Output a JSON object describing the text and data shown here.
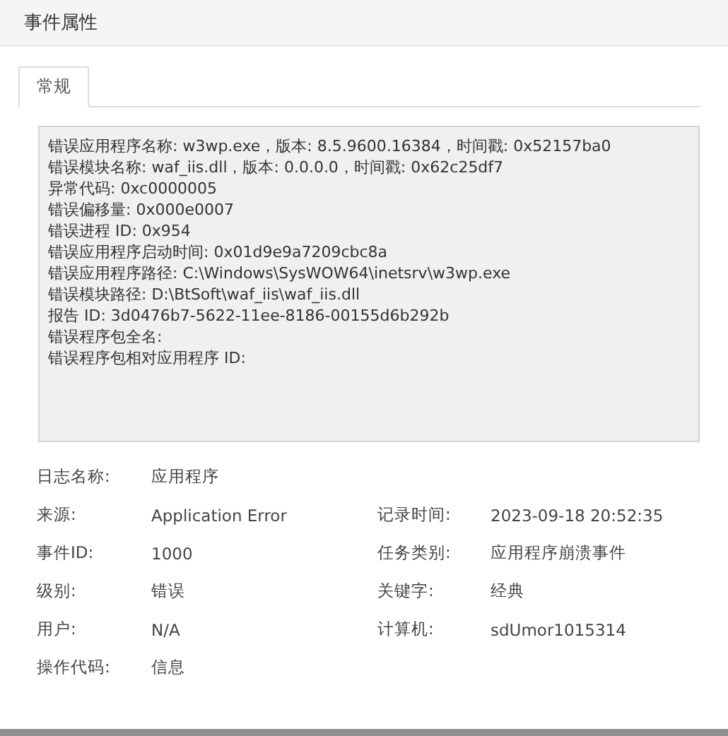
{
  "window": {
    "title": "事件属性"
  },
  "tabs": [
    {
      "label": "常规",
      "selected": true
    }
  ],
  "description_lines": [
    "错误应用程序名称: w3wp.exe，版本: 8.5.9600.16384，时间戳: 0x52157ba0",
    "错误模块名称: waf_iis.dll，版本: 0.0.0.0，时间戳: 0x62c25df7",
    "异常代码: 0xc0000005",
    "错误偏移量: 0x000e0007",
    "错误进程 ID: 0x954",
    "错误应用程序启动时间: 0x01d9e9a7209cbc8a",
    "错误应用程序路径: C:\\Windows\\SysWOW64\\inetsrv\\w3wp.exe",
    "错误模块路径: D:\\BtSoft\\waf_iis\\waf_iis.dll",
    "报告 ID: 3d0476b7-5622-11ee-8186-00155d6b292b",
    "错误程序包全名:",
    "错误程序包相对应用程序 ID:"
  ],
  "rows": [
    {
      "left": {
        "label": "日志名称:",
        "value": "应用程序"
      }
    },
    {
      "left": {
        "label": "来源:",
        "value": "Application Error"
      },
      "right": {
        "label": "记录时间:",
        "value": "2023-09-18 20:52:35"
      }
    },
    {
      "left": {
        "label": "事件ID:",
        "value": "1000"
      },
      "right": {
        "label": "任务类别:",
        "value": "应用程序崩溃事件"
      }
    },
    {
      "left": {
        "label": "级别:",
        "value": "错误"
      },
      "right": {
        "label": "关键字:",
        "value": "经典"
      }
    },
    {
      "left": {
        "label": "用户:",
        "value": "N/A"
      },
      "right": {
        "label": "计算机:",
        "value": "sdUmor1015314"
      }
    },
    {
      "left": {
        "label": "操作代码:",
        "value": "信息"
      }
    }
  ]
}
